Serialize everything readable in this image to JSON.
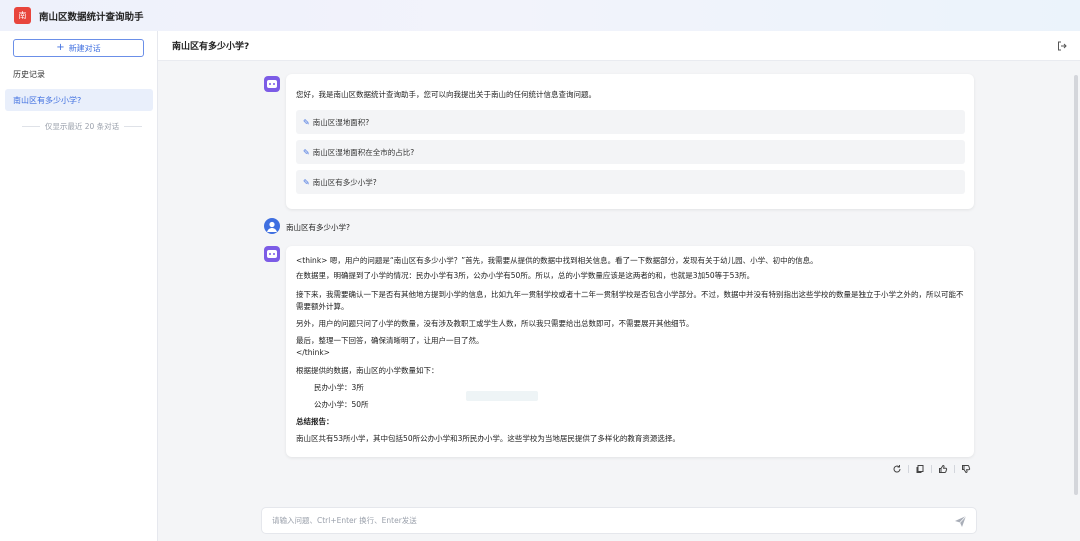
{
  "app": {
    "logo_text": "南",
    "title": "南山区数据统计查询助手",
    "accent": "#3f6fe0",
    "logo_color": "#e8453c"
  },
  "sidebar": {
    "new_chat_label": "新建对话",
    "history_label": "历史记录",
    "items": [
      {
        "label": "南山区有多少小学?"
      }
    ],
    "note": "仅显示最近 20 条对话"
  },
  "header": {
    "title": "南山区有多少小学?"
  },
  "greeting_card": {
    "text": "您好，我是南山区数据统计查询助手，您可以向我提出关于南山的任何统计信息查询问题。",
    "suggestions": [
      "南山区湿地面积?",
      "南山区湿地面积在全市的占比?",
      "南山区有多少小学?"
    ]
  },
  "user_message": {
    "text": "南山区有多少小学?"
  },
  "answer": {
    "think_1": "<think> 嗯，用户的问题是“南山区有多少小学？”首先，我需要从提供的数据中找到相关信息。看了一下数据部分，发现有关于幼儿园、小学、初中的信息。",
    "think_2": "在数据里，明确提到了小学的情况：民办小学有3所，公办小学有50所。所以，总的小学数量应该是这两者的和，也就是3加50等于53所。",
    "think_3": "接下来，我需要确认一下是否有其他地方提到小学的信息，比如九年一贯制学校或者十二年一贯制学校是否包含小学部分。不过，数据中并没有特别指出这些学校的数量是独立于小学之外的，所以可能不需要额外计算。",
    "think_4": "另外，用户的问题只问了小学的数量，没有涉及教职工或学生人数，所以我只需要给出总数即可，不需要展开其他细节。",
    "think_5": "最后，整理一下回答，确保清晰明了，让用户一目了然。",
    "think_end": "</think>",
    "intro": "根据提供的数据，南山区的小学数量如下：",
    "item_1": "民办小学：3所",
    "item_2": "公办小学：50所",
    "summary_title": "总结报告：",
    "summary": "南山区共有53所小学，其中包括50所公办小学和3所民办小学。这些学校为当地居民提供了多样化的教育资源选择。"
  },
  "action_icons": [
    "refresh-icon",
    "copy-icon",
    "thumbs-up-icon",
    "thumbs-down-icon"
  ],
  "composer": {
    "placeholder": "请输入问题、Ctrl+Enter 换行、Enter发送",
    "value": ""
  }
}
